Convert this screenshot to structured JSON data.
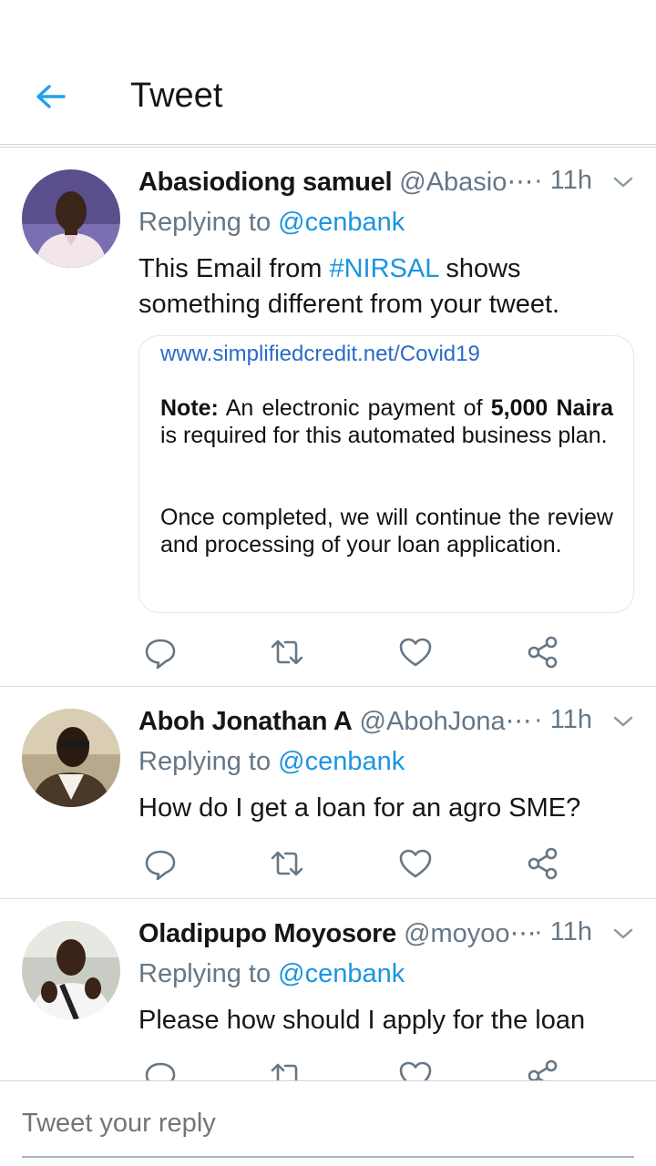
{
  "header": {
    "title": "Tweet",
    "back_icon": "arrow-left-icon",
    "accent_color": "#1da1f2"
  },
  "tweets": [
    {
      "name": "Abasiodiong samuel",
      "handle": "@Abasio⋯",
      "time": "· 11h",
      "replying_prefix": "Replying to ",
      "replying_to": "@cenbank",
      "text_part1": "This Email from ",
      "hashtag": "#NIRSAL",
      "text_part2": " shows something different from your tweet.",
      "card": {
        "url": "www.simplifiedcredit.net/Covid19",
        "note_label": "Note:",
        "note_part1": " An electronic payment of ",
        "note_amount": "5,000 Naira",
        "note_part2": " is required for this automated business plan.",
        "paragraph2": "Once completed, we will continue the review and processing of your loan application."
      }
    },
    {
      "name": "Aboh Jonathan A",
      "handle": "@AbohJona⋯",
      "time": "· 11h",
      "replying_prefix": "Replying to ",
      "replying_to": "@cenbank",
      "text": "How do I get a loan for an agro SME?"
    },
    {
      "name": "Oladipupo Moyosore",
      "handle": "@moyoo⋯",
      "time": "· 11h",
      "replying_prefix": "Replying to ",
      "replying_to": "@cenbank",
      "text": "Please how should I apply for the loan"
    }
  ],
  "composer": {
    "placeholder": "Tweet your reply"
  },
  "colors": {
    "link": "#1b95e0",
    "secondary_text": "#657786",
    "icon": "#657786"
  }
}
